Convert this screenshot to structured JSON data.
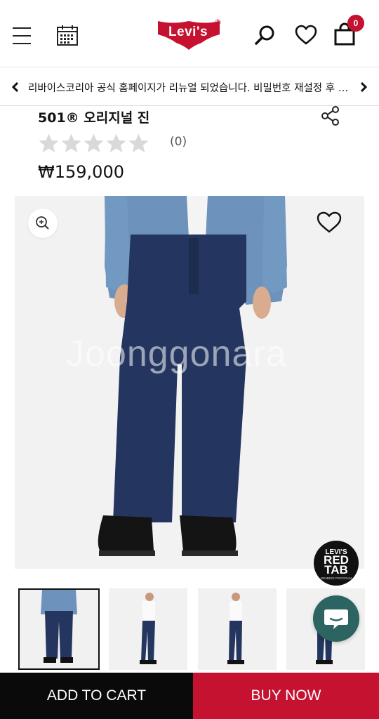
{
  "header": {
    "menu_icon": "hamburger-menu-icon",
    "calendar_icon": "calendar-icon",
    "logo_text": "Levi's",
    "logo_reg": "®",
    "search_icon": "search-icon",
    "wishlist_icon": "heart-icon",
    "bag_icon": "shopping-bag-icon",
    "cart_count": "0",
    "brand_color": "#c41230"
  },
  "announcement": {
    "text": "리바이스코리아 공식 홈페이지가 리뉴얼 되었습니다. 비밀번호 재설정 후 이용해주세요.",
    "prev_icon": "chevron-left-icon",
    "next_icon": "chevron-right-icon"
  },
  "product": {
    "title": "501® 오리지널 진",
    "rating": 0,
    "rating_max": 5,
    "review_count": "(0)",
    "price": "₩159,000",
    "share_icon": "share-icon"
  },
  "gallery": {
    "zoom_icon": "zoom-in-icon",
    "wish_icon": "heart-outline-icon",
    "watermark": "Joonggonara",
    "badge": {
      "line1": "LEVI'S",
      "line2": "RED",
      "line3": "TAB",
      "line4": "MEMBER PROGRAM"
    },
    "active_thumbnail": 1
  },
  "chat": {
    "icon": "chat-bubble-icon",
    "color": "#2b6461"
  },
  "actions": {
    "add_to_cart": "ADD TO CART",
    "buy_now": "BUY NOW"
  }
}
